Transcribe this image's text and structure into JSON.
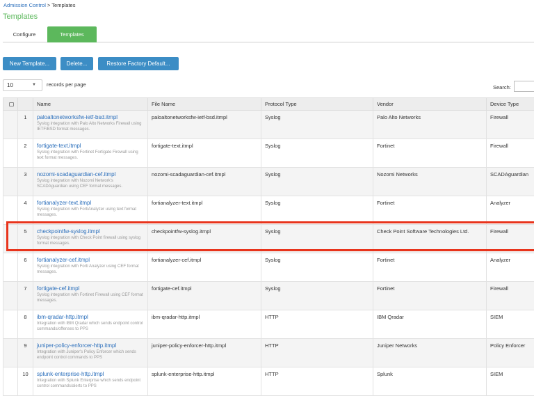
{
  "breadcrumb": {
    "parent": "Admission Control",
    "separator": " > ",
    "current": "Templates"
  },
  "page_title": "Templates",
  "tabs": [
    {
      "label": "Configure",
      "active": false
    },
    {
      "label": "Templates",
      "active": true
    }
  ],
  "toolbar": {
    "new_label": "New Template...",
    "delete_label": "Delete...",
    "restore_label": "Restore Factory Default..."
  },
  "pagination": {
    "page_size": "10",
    "records_label": "records per page"
  },
  "search": {
    "label": "Search:",
    "value": ""
  },
  "table": {
    "columns": [
      "Name",
      "File Name",
      "Protocol Type",
      "Vendor",
      "Device Type"
    ],
    "rows": [
      {
        "num": "1",
        "name": "paloaltonetworksfw-ietf-bsd.itmpl",
        "desc": "Syslog integration with Palo Alto Networks Firewall using IETF/BSD format messages.",
        "file": "paloaltonetworksfw-ietf-bsd.itmpl",
        "protocol": "Syslog",
        "vendor": "Palo Alto Networks",
        "device": "Firewall"
      },
      {
        "num": "2",
        "name": "fortigate-text.itmpl",
        "desc": "Syslog integration with Fortinet Fortigate Firewall using text format messages.",
        "file": "fortigate-text.itmpl",
        "protocol": "Syslog",
        "vendor": "Fortinet",
        "device": "Firewall"
      },
      {
        "num": "3",
        "name": "nozomi-scadaguardian-cef.itmpl",
        "desc": "Syslog integration with Nozomi Network's SCADAguardian using CEF format messages.",
        "file": "nozomi-scadaguardian-cef.itmpl",
        "protocol": "Syslog",
        "vendor": "Nozomi Networks",
        "device": "SCADAguardian"
      },
      {
        "num": "4",
        "name": "fortianalyzer-text.itmpl",
        "desc": "Syslog integration with FortiAnalyzer using text format messages.",
        "file": "fortianalyzer-text.itmpl",
        "protocol": "Syslog",
        "vendor": "Fortinet",
        "device": "Analyzer"
      },
      {
        "num": "5",
        "name": "checkpointfw-syslog.itmpl",
        "desc": "Syslog integration with Check Point firewall using syslog format messages.",
        "file": "checkpointfw-syslog.itmpl",
        "protocol": "Syslog",
        "vendor": "Check Point Software Technologies Ltd.",
        "device": "Firewall"
      },
      {
        "num": "6",
        "name": "fortianalyzer-cef.itmpl",
        "desc": "Syslog integration with Forti Analyzer using CEF format messages.",
        "file": "fortianalyzer-cef.itmpl",
        "protocol": "Syslog",
        "vendor": "Fortinet",
        "device": "Analyzer"
      },
      {
        "num": "7",
        "name": "fortigate-cef.itmpl",
        "desc": "Syslog integration with Fortinet Firewall using CEF format messages.",
        "file": "fortigate-cef.itmpl",
        "protocol": "Syslog",
        "vendor": "Fortinet",
        "device": "Firewall"
      },
      {
        "num": "8",
        "name": "ibm-qradar-http.itmpl",
        "desc": "Integration with IBM Qradar which sends endpoint control commands/offenses to PPS",
        "file": "ibm-qradar-http.itmpl",
        "protocol": "HTTP",
        "vendor": "IBM Qradar",
        "device": "SIEM"
      },
      {
        "num": "9",
        "name": "juniper-policy-enforcer-http.itmpl",
        "desc": "Integration with Juniper's Policy Enforcer which sends endpoint control commands to PPS",
        "file": "juniper-policy-enforcer-http.itmpl",
        "protocol": "HTTP",
        "vendor": "Juniper Networks",
        "device": "Policy Enforcer"
      },
      {
        "num": "10",
        "name": "splunk-enterprise-http.itmpl",
        "desc": "Integration with Splunk Enterprise which sends endpoint control commands/alerts to PPS",
        "file": "splunk-enterprise-http.itmpl",
        "protocol": "HTTP",
        "vendor": "Splunk",
        "device": "SIEM"
      }
    ]
  },
  "colors": {
    "accent_green": "#5cb85c",
    "button_blue": "#3c8dc5",
    "link_blue": "#2a6ebb",
    "highlight_red": "#e8341c"
  },
  "highlighted_row": "5"
}
